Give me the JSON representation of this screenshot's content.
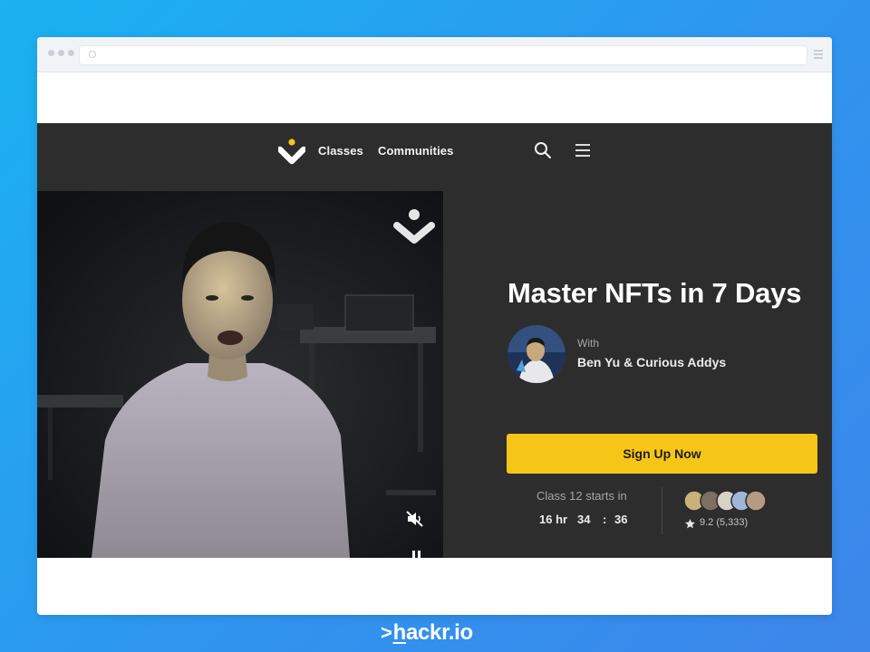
{
  "nav": {
    "links": [
      "Classes",
      "Communities"
    ],
    "icons": [
      "brand-logo-icon",
      "search-icon",
      "hamburger-menu-icon"
    ]
  },
  "course": {
    "title": "Master NFTs in 7 Days",
    "with_label": "With",
    "instructors": "Ben Yu & Curious Addys",
    "cta_label": "Sign Up Now",
    "starts_label": "Class 12 starts in",
    "countdown": {
      "hours": "16 hr",
      "minutes": "34",
      "separator": ":",
      "seconds": "36"
    },
    "rating": "9.2 (5,333)"
  },
  "video": {
    "icons": [
      "brand-watermark-icon",
      "mute-icon",
      "pause-icon"
    ]
  },
  "brand": {
    "prompt": ">",
    "h": "h",
    "rest": "ackr.io"
  },
  "colors": {
    "page_background_start": "#1ab2f0",
    "page_background_end": "#3c86ea",
    "site_background": "#2d2d2d",
    "accent": "#f5c518",
    "text_primary": "#ffffff",
    "text_muted": "#a5a5a5"
  }
}
